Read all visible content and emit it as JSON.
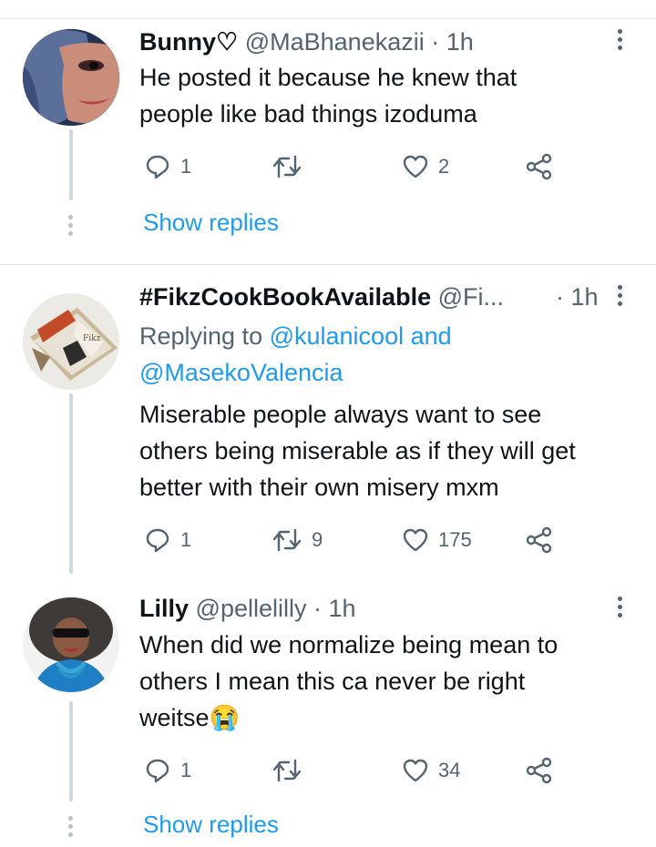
{
  "tweets": [
    {
      "name": "Bunny♡",
      "handle": "@MaBhanekazii",
      "dot": " · ",
      "time": "1h",
      "line1": "He posted it because he knew that",
      "line2": "people like bad things izoduma",
      "replies": "1",
      "retweets": "",
      "likes": "2",
      "show_replies": "Show replies"
    },
    {
      "name": "#FikzCookBookAvailable",
      "handle": "@Fi...",
      "dot": " · ",
      "time": "1h",
      "replying_prefix": "Replying to ",
      "mention1": "@kulanicool",
      "and": " and",
      "mention2": "@MasekoValencia",
      "line1": "Miserable people always want to see",
      "line2": "others being miserable as if they will get",
      "line3": "better with their own misery mxm",
      "replies": "1",
      "retweets": "9",
      "likes": "175"
    },
    {
      "name": "Lilly",
      "handle": "@pellelilly",
      "dot": " · ",
      "time": "1h",
      "line1": "When did we normalize being mean to",
      "line2": "others I mean this ca never be right",
      "line3": "weitse😭",
      "replies": "1",
      "retweets": "",
      "likes": "34",
      "show_replies": "Show replies"
    }
  ],
  "icons": {
    "reply": "reply-icon",
    "retweet": "retweet-icon",
    "like": "heart-icon",
    "share": "share-icon",
    "more": "more-icon"
  },
  "colors": {
    "link": "#1d9bf0",
    "muted": "#536471",
    "thread_line": "#cfd9de"
  }
}
